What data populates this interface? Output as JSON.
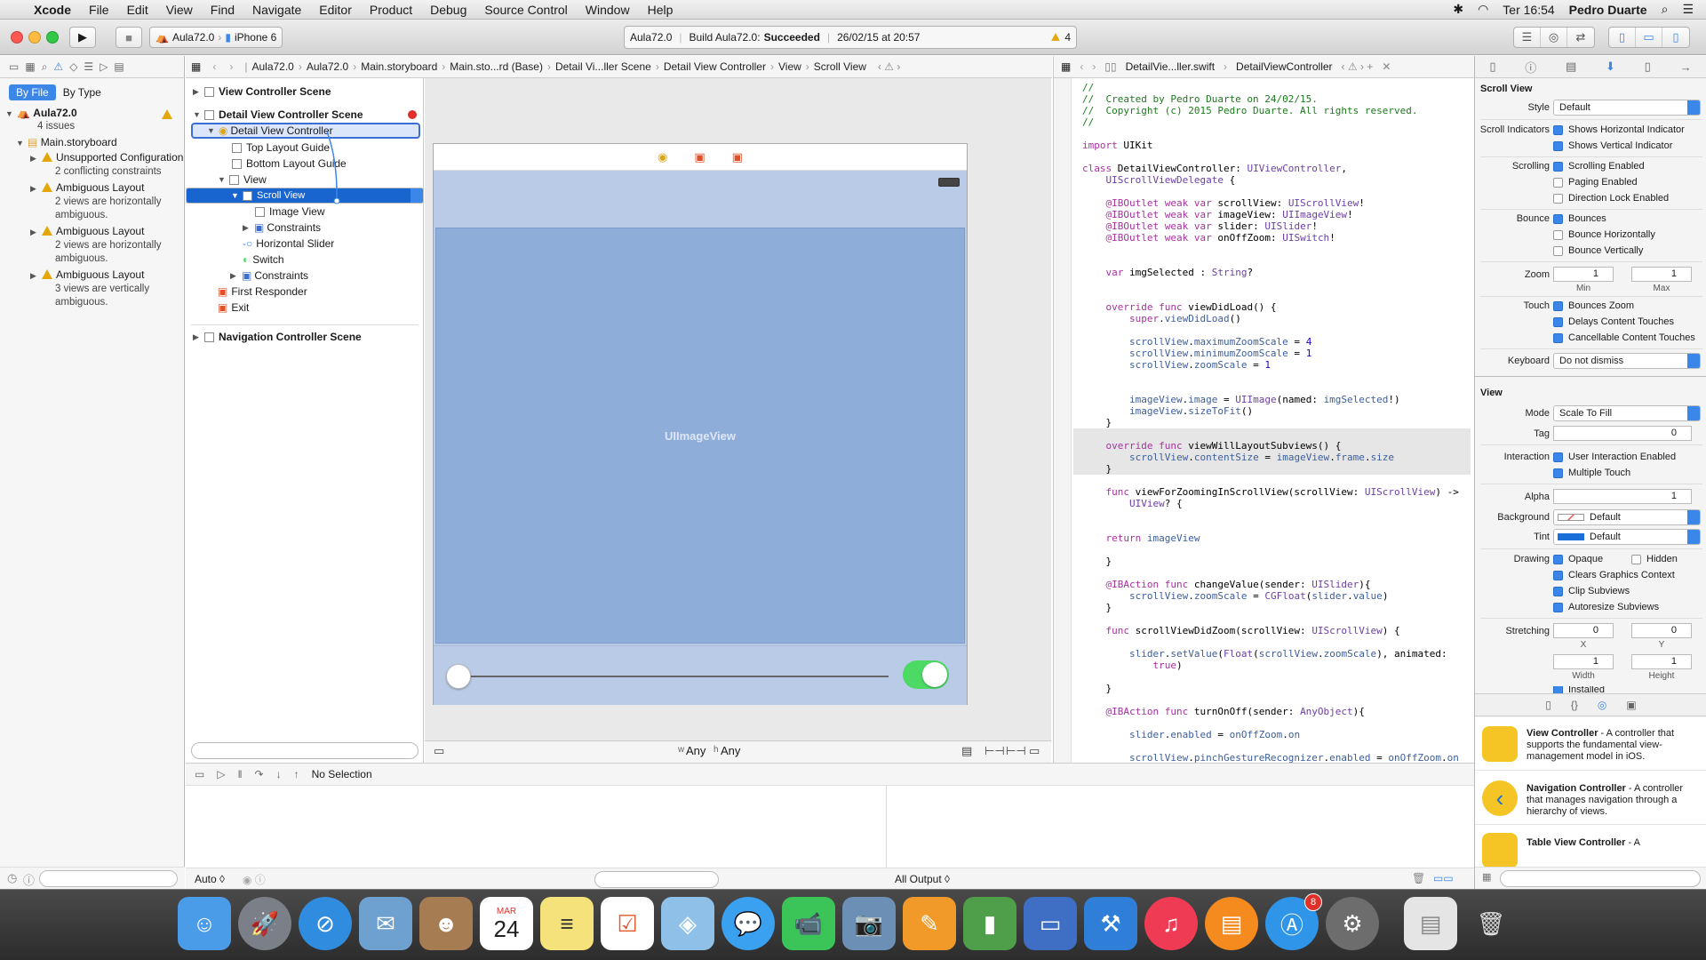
{
  "menubar": {
    "apple": "",
    "app": "Xcode",
    "items": [
      "File",
      "Edit",
      "View",
      "Find",
      "Navigate",
      "Editor",
      "Product",
      "Debug",
      "Source Control",
      "Window",
      "Help"
    ],
    "clock": "Ter 16:54",
    "user": "Pedro Duarte"
  },
  "toolbar": {
    "scheme_target": "Aula72.0",
    "scheme_device": "iPhone 6",
    "status_project": "Aula72.0",
    "status_build_prefix": "Build Aula72.0:",
    "status_build_result": "Succeeded",
    "status_time": "26/02/15 at 20:57",
    "warning_count": "4"
  },
  "navigator": {
    "seg_by_file": "By File",
    "seg_by_type": "By Type",
    "project": "Aula72.0",
    "project_sub": "4 issues",
    "storyboard": "Main.storyboard",
    "issues": [
      {
        "title": "Unsupported Configuration",
        "sub": "2 conflicting constraints"
      },
      {
        "title": "Ambiguous Layout",
        "sub": "2 views are horizontally ambiguous."
      },
      {
        "title": "Ambiguous Layout",
        "sub": "2 views are horizontally ambiguous."
      },
      {
        "title": "Ambiguous Layout",
        "sub": "3 views are vertically ambiguous."
      }
    ]
  },
  "jumpbar": {
    "items": [
      "Aula72.0",
      "Aula72.0",
      "Main.storyboard",
      "Main.sto...rd (Base)",
      "Detail Vi...ller Scene",
      "Detail View Controller",
      "View",
      "Scroll View"
    ]
  },
  "outline": {
    "scene1": "View Controller Scene",
    "scene2": "Detail View Controller Scene",
    "dvc": "Detail View Controller",
    "top_guide": "Top Layout Guide",
    "bottom_guide": "Bottom Layout Guide",
    "view": "View",
    "scroll_view": "Scroll View",
    "image_view": "Image View",
    "constraints1": "Constraints",
    "slider": "Horizontal Slider",
    "switch": "Switch",
    "constraints2": "Constraints",
    "first_responder": "First Responder",
    "exit": "Exit",
    "scene3": "Navigation Controller Scene"
  },
  "canvas": {
    "image_label": "UIImageView",
    "size_class_w": "Any",
    "size_class_h": "Any",
    "w_prefix": "w",
    "h_prefix": "h"
  },
  "code_jump": {
    "file": "DetailVie...ller.swift",
    "class": "DetailViewController"
  },
  "inspector": {
    "scroll_section": "Scroll View",
    "style_label": "Style",
    "style_value": "Default",
    "scroll_ind_label": "Scroll Indicators",
    "show_h": "Shows Horizontal Indicator",
    "show_v": "Shows Vertical Indicator",
    "scrolling_label": "Scrolling",
    "scroll_enabled": "Scrolling Enabled",
    "paging": "Paging Enabled",
    "dir_lock": "Direction Lock Enabled",
    "bounce_label": "Bounce",
    "bounces": "Bounces",
    "bounce_h": "Bounce Horizontally",
    "bounce_v": "Bounce Vertically",
    "zoom_label": "Zoom",
    "zoom_min": "1",
    "zoom_max": "1",
    "min_cap": "Min",
    "max_cap": "Max",
    "touch_label": "Touch",
    "bounces_zoom": "Bounces Zoom",
    "delays": "Delays Content Touches",
    "cancellable": "Cancellable Content Touches",
    "keyboard_label": "Keyboard",
    "keyboard_value": "Do not dismiss",
    "view_section": "View",
    "mode_label": "Mode",
    "mode_value": "Scale To Fill",
    "tag_label": "Tag",
    "tag_value": "0",
    "interaction_label": "Interaction",
    "user_interaction": "User Interaction Enabled",
    "multi_touch": "Multiple Touch",
    "alpha_label": "Alpha",
    "alpha_value": "1",
    "background_label": "Background",
    "background_value": "Default",
    "tint_label": "Tint",
    "tint_value": "Default",
    "drawing_label": "Drawing",
    "opaque": "Opaque",
    "hidden": "Hidden",
    "clears": "Clears Graphics Context",
    "clip": "Clip Subviews",
    "autoresize": "Autoresize Subviews",
    "stretching_label": "Stretching",
    "st_x": "0",
    "st_y": "0",
    "st_w": "1",
    "st_h": "1",
    "x_cap": "X",
    "y_cap": "Y",
    "w_cap": "Width",
    "h_cap": "Height",
    "installed": "Installed",
    "library": [
      {
        "title": "View Controller",
        "desc": " - A controller that supports the fundamental view-management model in iOS."
      },
      {
        "title": "Navigation Controller",
        "desc": " - A controller that manages navigation through a hierarchy of views."
      },
      {
        "title": "Table View Controller",
        "desc": " - A"
      }
    ]
  },
  "debug": {
    "no_selection": "No Selection",
    "auto": "Auto ◊",
    "all_output": "All Output ◊"
  },
  "colors": {
    "accent": "#3b87e9",
    "selection": "#1865d0",
    "warning": "#e3a70b",
    "switch_on": "#4cd964"
  },
  "dock": {
    "calendar_month": "MAR",
    "calendar_day": "24",
    "appstore_badge": "8"
  }
}
